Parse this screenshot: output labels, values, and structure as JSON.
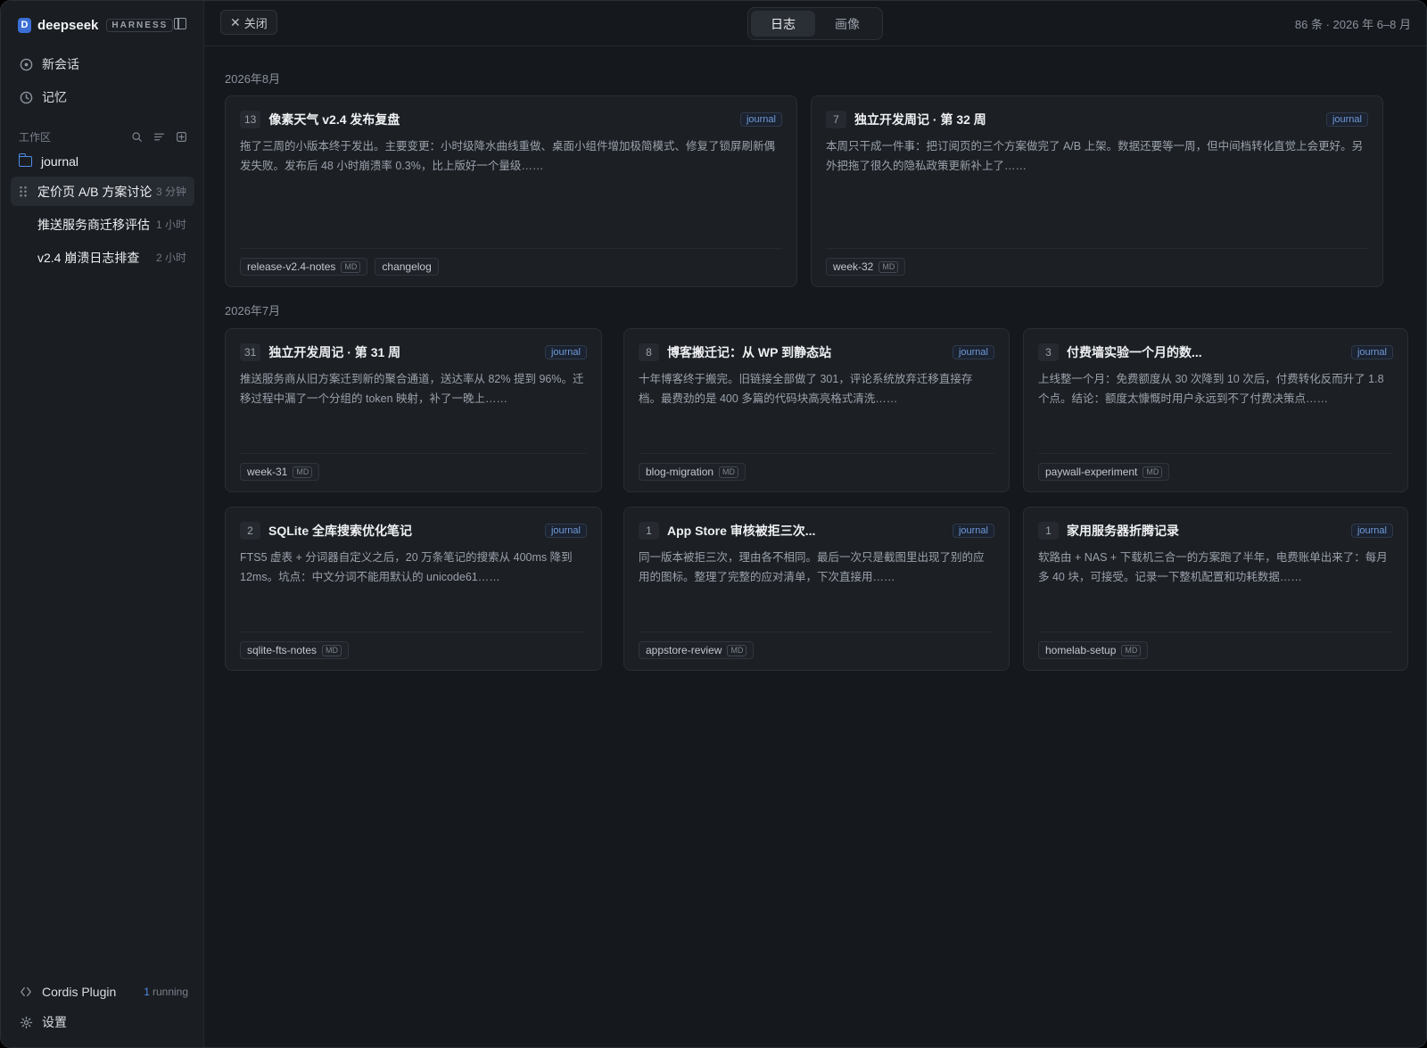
{
  "brand": {
    "logo": "D",
    "name": "deepseek",
    "badge": "HARNESS"
  },
  "nav": [
    {
      "label": "新会话",
      "icon": "plus-circle-icon"
    },
    {
      "label": "记忆",
      "icon": "clock-icon"
    }
  ],
  "workspace": {
    "title": "工作区",
    "folder": "journal"
  },
  "sessions": [
    {
      "title": "定价页 A/B 方案讨论",
      "time": "3 分钟"
    },
    {
      "title": "推送服务商迁移评估",
      "time": "1 小时"
    },
    {
      "title": "v2.4 崩溃日志排查",
      "time": "2 小时"
    }
  ],
  "footer": {
    "plugin": {
      "label": "Cordis Plugin",
      "count": "1",
      "status": "running"
    },
    "settings": "设置"
  },
  "topbar": {
    "close_label": "关闭",
    "tabs": [
      "日志",
      "画像"
    ],
    "active_tab": "日志",
    "meta": "86 条 · 2026 年 6–8 月"
  },
  "months": [
    "2026年8月",
    "2026年7月"
  ],
  "cards": [
    {
      "count": "13",
      "title": "像素天气 v2.4 发布复盘",
      "tag": "journal",
      "body": "拖了三周的小版本终于发出。主要变更：小时级降水曲线重做、桌面小组件增加极简模式、修复了锁屏刷新偶发失败。发布后 48 小时崩溃率 0.3%，比上版好一个量级……",
      "chips": [
        {
          "label": "release-v2.4-notes",
          "md": "MD"
        },
        {
          "label": "changelog",
          "md": ""
        }
      ]
    },
    {
      "count": "7",
      "title": "独立开发周记 · 第 32 周",
      "tag": "journal",
      "body": "本周只干成一件事：把订阅页的三个方案做完了 A/B 上架。数据还要等一周，但中间档转化直觉上会更好。另外把拖了很久的隐私政策更新补上了……",
      "chips": [
        {
          "label": "week-32",
          "md": "MD"
        }
      ]
    },
    {
      "count": "31",
      "title": "独立开发周记 · 第 31 周",
      "tag": "journal",
      "body": "推送服务商从旧方案迁到新的聚合通道，送达率从 82% 提到 96%。迁移过程中漏了一个分组的 token 映射，补了一晚上……",
      "chips": [
        {
          "label": "week-31",
          "md": "MD"
        }
      ]
    },
    {
      "count": "8",
      "title": "博客搬迁记：从 WP 到静态站",
      "tag": "journal",
      "body": "十年博客终于搬完。旧链接全部做了 301，评论系统放弃迁移直接存档。最费劲的是 400 多篇的代码块高亮格式清洗……",
      "chips": [
        {
          "label": "blog-migration",
          "md": "MD"
        }
      ]
    },
    {
      "count": "3",
      "title": "付费墙实验一个月的数...",
      "tag": "journal",
      "body": "上线整一个月：免费额度从 30 次降到 10 次后，付费转化反而升了 1.8 个点。结论：额度太慷慨时用户永远到不了付费决策点……",
      "chips": [
        {
          "label": "paywall-experiment",
          "md": "MD"
        }
      ]
    },
    {
      "count": "2",
      "title": "SQLite 全库搜索优化笔记",
      "tag": "journal",
      "body": "FTS5 虚表 + 分词器自定义之后，20 万条笔记的搜索从 400ms 降到 12ms。坑点：中文分词不能用默认的 unicode61……",
      "chips": [
        {
          "label": "sqlite-fts-notes",
          "md": "MD"
        }
      ]
    },
    {
      "count": "1",
      "title": "App Store 审核被拒三次...",
      "tag": "journal",
      "body": "同一版本被拒三次，理由各不相同。最后一次只是截图里出现了别的应用的图标。整理了完整的应对清单，下次直接用……",
      "chips": [
        {
          "label": "appstore-review",
          "md": "MD"
        }
      ]
    },
    {
      "count": "1",
      "title": "家用服务器折腾记录",
      "tag": "journal",
      "body": "软路由 + NAS + 下载机三合一的方案跑了半年，电费账单出来了：每月多 40 块，可接受。记录一下整机配置和功耗数据……",
      "chips": [
        {
          "label": "homelab-setup",
          "md": "MD"
        }
      ]
    }
  ]
}
